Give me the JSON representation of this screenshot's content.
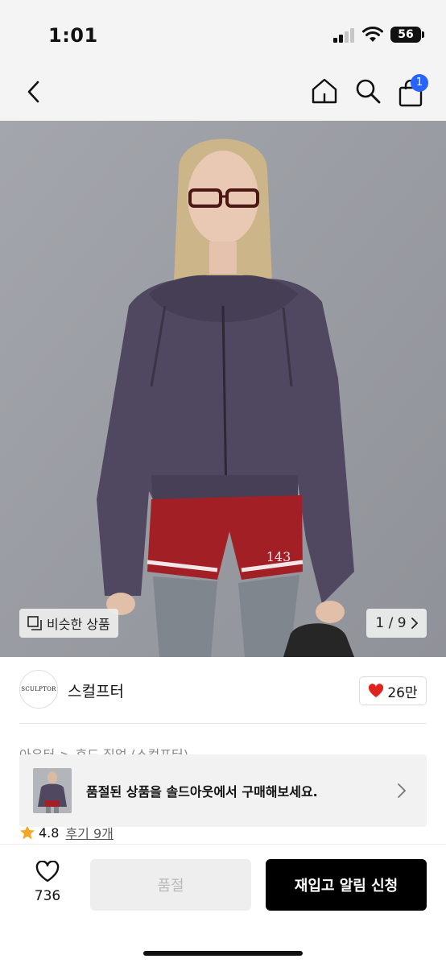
{
  "status_bar": {
    "time": "1:01",
    "battery": "56",
    "signal_bars_on": 2,
    "signal_bars_total": 4
  },
  "nav": {
    "cart_badge": "1"
  },
  "gallery": {
    "similar_label": "비슷한 상품",
    "pager_text": "1 / 9",
    "shorts_number": "143"
  },
  "brand": {
    "logo_text": "SCULPTOR",
    "name": "스컬프터",
    "likes": "26만"
  },
  "category": {
    "level1": "아우터",
    "separator": ">",
    "level2": "후드 집업 (스컬프터)"
  },
  "soldout_banner": {
    "text": "품절된 상품을 솔드아웃에서 구매해보세요."
  },
  "rating": {
    "score": "4.8",
    "reviews": "후기 9개"
  },
  "bottom_bar": {
    "wish_count": "736",
    "soldout_label": "품절",
    "restock_label": "재입고 알림 신청"
  },
  "colors": {
    "accent_badge": "#2764ff",
    "heart": "#e0231c",
    "star": "#f5a623",
    "primary_button": "#000000",
    "disabled_button": "#eeeeee"
  }
}
